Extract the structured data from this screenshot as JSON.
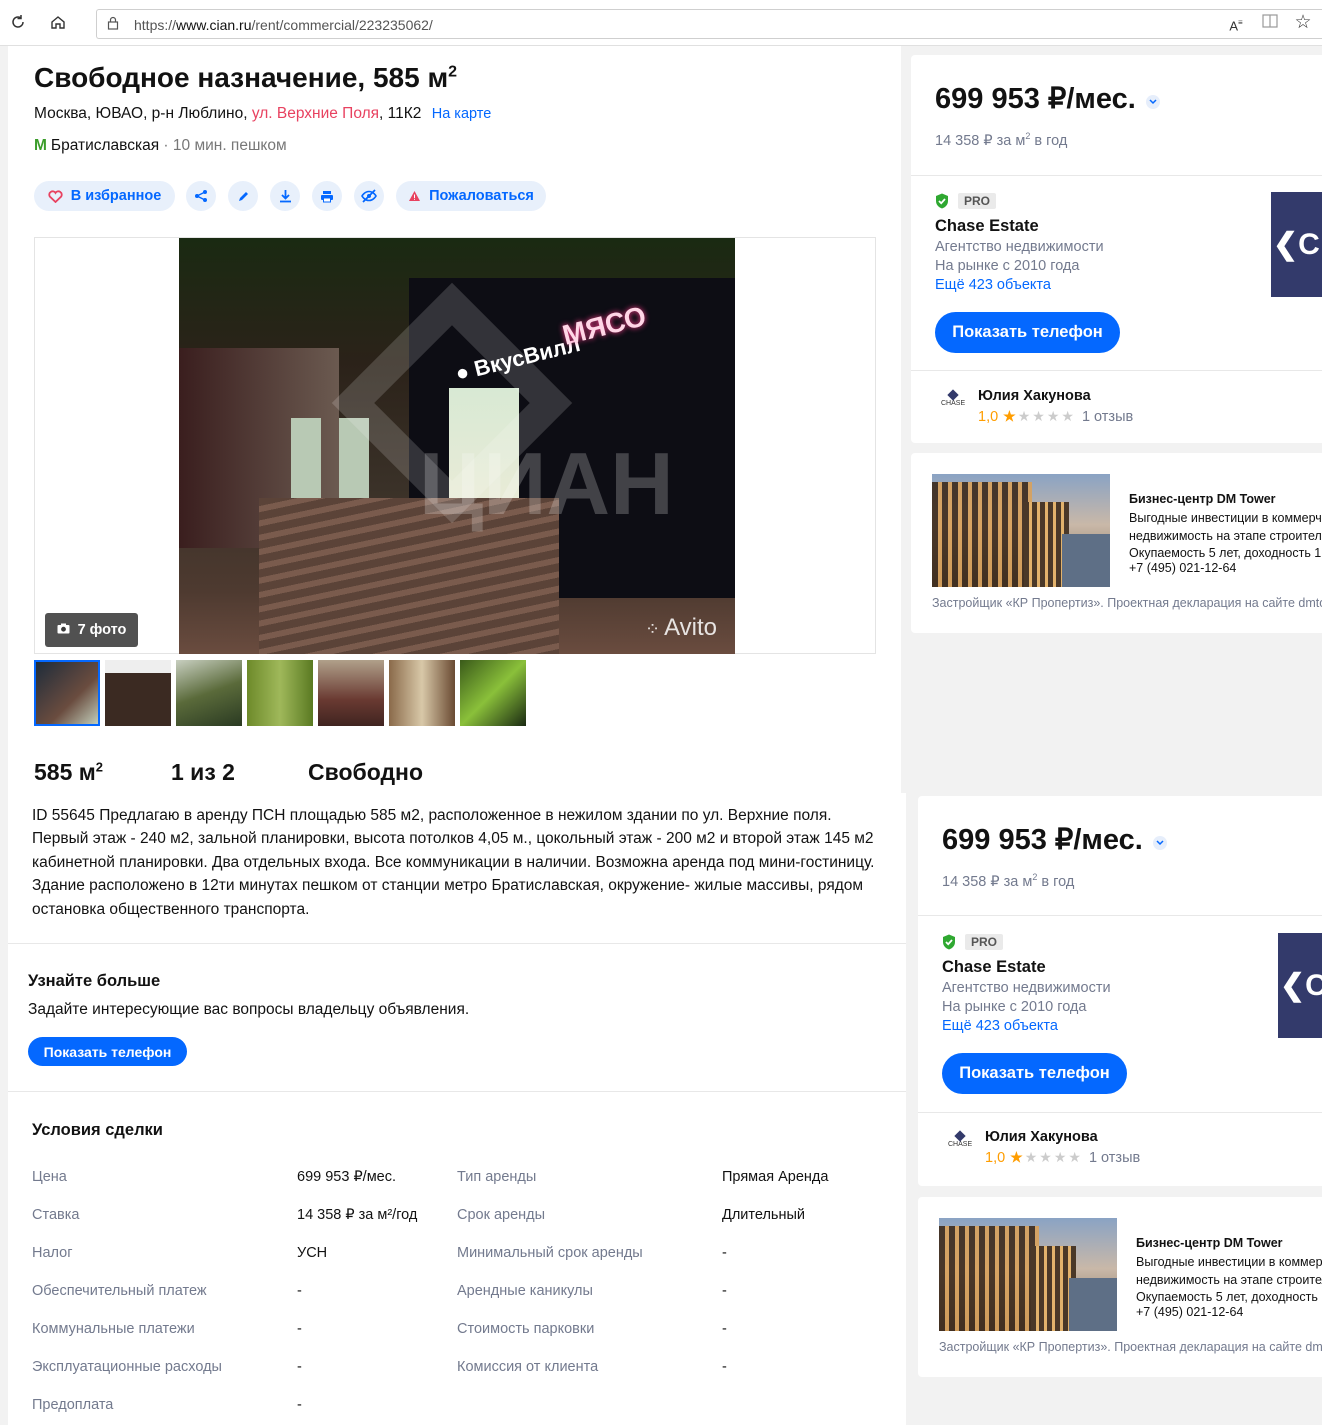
{
  "browser": {
    "url_prefix": "https://",
    "url_host": "www.cian.ru",
    "url_path": "/rent/commercial/223235062/",
    "icons": [
      "refresh-icon",
      "home-icon",
      "lock-icon",
      "read-aloud-icon",
      "reading-view-icon",
      "favorite-star-icon"
    ]
  },
  "offer": {
    "title": "Свободное назначение, 585 м",
    "title_sup": "2",
    "address_prefix": "Москва, ЮВАО, р-н Люблино, ",
    "address_street": "ул. Верхние Поля",
    "address_house": ", 11К2",
    "map_link": "На карте",
    "metro_icon": "М",
    "metro_station": "Братиславская",
    "metro_walk": " · 10 мин. пешком"
  },
  "actions": {
    "favorite": "В избранное",
    "complain": "Пожаловаться",
    "icons": [
      "heart-icon",
      "share-icon",
      "edit-icon",
      "download-icon",
      "print-icon",
      "hide-icon",
      "warning-icon"
    ]
  },
  "gallery": {
    "photo_count": "7 фото",
    "sign_vkusvill": "ВкусВилл",
    "sign_myaso": "МЯСО",
    "watermark": "ЦИАН",
    "avito": "Avito",
    "thumb_count": 7
  },
  "facts": {
    "area": "585 м",
    "area_sup": "2",
    "floor": "1 из 2",
    "status": "Свободно"
  },
  "description": "ID 55645 Предлагаю в аренду ПСН площадью 585 м2, расположенное в нежилом здании по ул. Верхние поля. Первый этаж - 240 м2, зальной планировки, высота потолков 4,05 м., цокольный этаж - 200 м2 и второй этаж 145 м2 кабинетной планировки. Два отдельных входа. Все коммуникации в наличии. Возможна аренда под мини-гостиницу. Здание расположено в 12ти минутах пешком от станции метро Братиславская, окружение- жилые массивы, рядом остановка общественного транспорта.",
  "learn_more": {
    "title": "Узнайте больше",
    "text": "Задайте интересующие вас вопросы владельцу объявления.",
    "button": "Показать телефон"
  },
  "terms": {
    "title": "Условия сделки",
    "left": [
      {
        "label": "Цена",
        "value": "699 953 ₽/мес."
      },
      {
        "label": "Ставка",
        "value": "14 358 ₽ за м²/год"
      },
      {
        "label": "Налог",
        "value": "УСН"
      },
      {
        "label": "Обеспечительный платеж",
        "value": "-"
      },
      {
        "label": "Коммунальные платежи",
        "value": "-"
      },
      {
        "label": "Эксплуатационные расходы",
        "value": "-"
      },
      {
        "label": "Предоплата",
        "value": "-"
      }
    ],
    "right": [
      {
        "label": "Тип аренды",
        "value": "Прямая Аренда"
      },
      {
        "label": "Срок аренды",
        "value": "Длительный"
      },
      {
        "label": "Минимальный срок аренды",
        "value": "-"
      },
      {
        "label": "Арендные каникулы",
        "value": "-"
      },
      {
        "label": "Стоимость парковки",
        "value": "-"
      },
      {
        "label": "Комиссия от клиента",
        "value": "-"
      }
    ]
  },
  "sidebar": {
    "price": "699 953 ₽/мес.",
    "per_m2_prefix": "14 358 ₽ за м",
    "per_m2_sup": "2",
    "per_m2_suffix": " в год",
    "pro_badge": "PRO",
    "agency": "Chase Estate",
    "agency_type": "Агентство недвижимости",
    "on_market": "На рынке с 2010 года",
    "more_objects": "Ещё 423 объекта",
    "logo_text": "C",
    "phone_button": "Показать телефон",
    "agent_logo": "CHASE",
    "agent_name": "Юлия Хакунова",
    "rating": "1,0",
    "reviews": "1 отзыв"
  },
  "promo": {
    "title": "Бизнес-центр DM Tower",
    "line1": "Выгодные инвестиции в коммерческую",
    "line2": "недвижимость на этапе строительства",
    "line3": "Окупаемость 5 лет, доходность 1",
    "phone": "+7 (495) 021-12-64",
    "footer": "Застройщик «КР Пропертиз». Проектная декларация на сайте dmtower.ru"
  },
  "colors": {
    "accent": "#0468ff",
    "street": "#e84260",
    "metro": "#3b9d2a",
    "star": "#ff9d00",
    "muted": "#737a8e"
  }
}
